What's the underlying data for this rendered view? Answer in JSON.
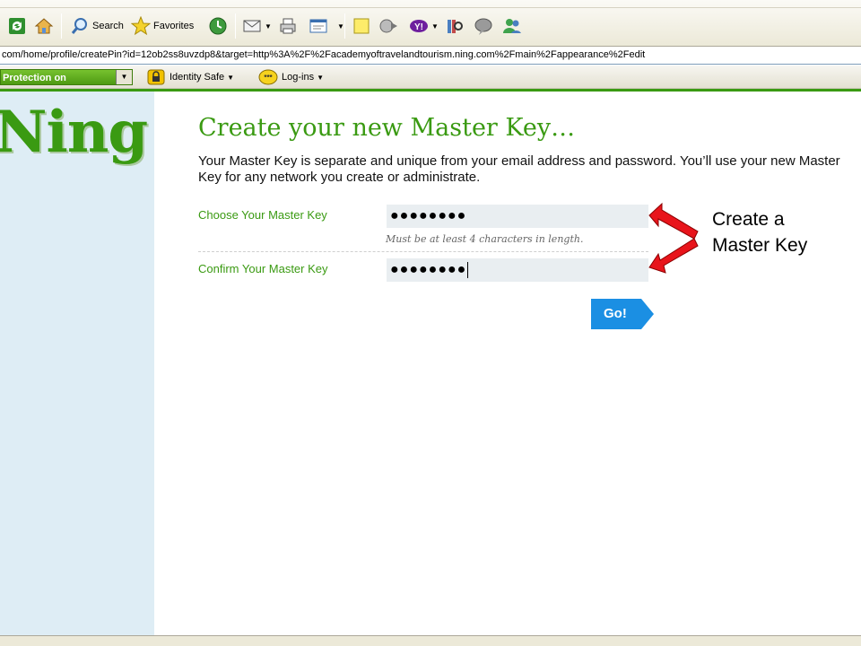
{
  "toolbar": {
    "search_label": "Search",
    "favorites_label": "Favorites"
  },
  "address": {
    "url": "com/home/profile/createPin?id=12ob2ss8uvzdp8&target=http%3A%2F%2Facademyoftravelandtourism.ning.com%2Fmain%2Fappearance%2Fedit"
  },
  "security": {
    "protection_label": "Protection on",
    "identity_safe_label": "Identity Safe",
    "logins_label": "Log-ins"
  },
  "page": {
    "logo": "Ning",
    "title": "Create your new Master Key…",
    "description": "Your Master Key is separate and unique from your email address and password. You’ll use your new Master Key for any network you create or administrate.",
    "choose_label": "Choose Your Master Key",
    "choose_value": "●●●●●●●●",
    "hint": "Must be at least 4 characters in length.",
    "confirm_label": "Confirm Your Master Key",
    "confirm_value": "●●●●●●●●",
    "go_label": "Go!"
  },
  "annotation": {
    "text": "Create a Master Key",
    "color": "#e8141b"
  },
  "colors": {
    "brand_green": "#3a9a12",
    "sidebar": "#deedf5",
    "button_blue": "#1b8fe3"
  }
}
